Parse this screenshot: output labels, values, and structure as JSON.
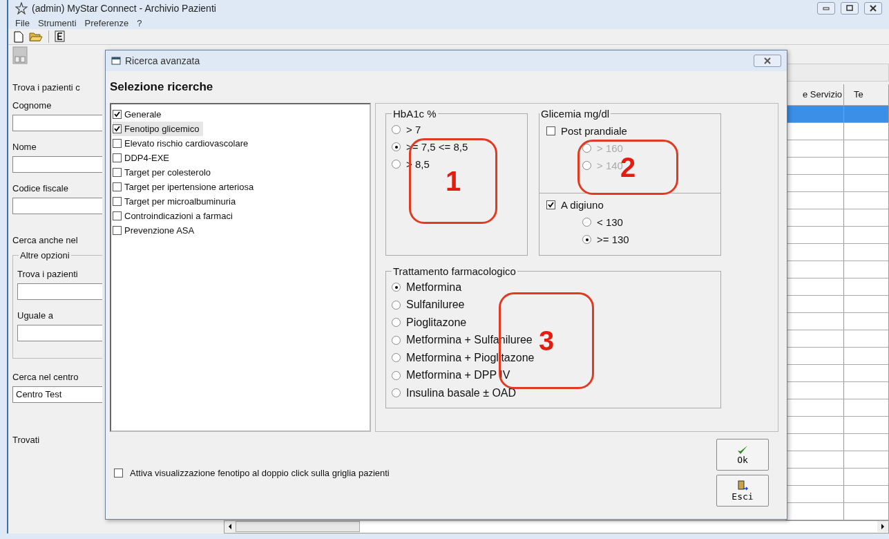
{
  "window": {
    "title": "(admin) MyStar Connect - Archivio Pazienti"
  },
  "menu": [
    "File",
    "Strumenti",
    "Preferenze",
    "?"
  ],
  "search_panel": {
    "intro": "Trova i pazienti c",
    "fields": [
      {
        "label": "Cognome"
      },
      {
        "label": "Nome"
      },
      {
        "label": "Codice fiscale"
      }
    ],
    "also_search": "Cerca anche nel",
    "other_options": {
      "title": "Altre opzioni",
      "fields": [
        {
          "label": "Trova i pazienti"
        },
        {
          "label": "Uguale a"
        }
      ]
    },
    "center": {
      "label": "Cerca nel centro",
      "value": "Centro Test"
    },
    "found": "Trovati"
  },
  "grid": {
    "columns": [
      "e Servizio",
      "Te"
    ],
    "rows": [
      {
        "selected": true
      },
      {
        "selected": false
      },
      {
        "selected": false
      },
      {
        "selected": false
      },
      {
        "selected": false
      },
      {
        "selected": false
      },
      {
        "selected": false
      },
      {
        "selected": false
      },
      {
        "selected": false
      },
      {
        "selected": false
      },
      {
        "selected": false
      },
      {
        "selected": false
      },
      {
        "selected": false
      },
      {
        "selected": false
      },
      {
        "selected": false
      },
      {
        "selected": false
      },
      {
        "selected": false
      },
      {
        "selected": false
      },
      {
        "selected": false
      },
      {
        "selected": false
      },
      {
        "selected": false
      },
      {
        "selected": false
      },
      {
        "selected": false
      },
      {
        "selected": false
      }
    ]
  },
  "dialog": {
    "title": "Ricerca avanzata",
    "heading": "Selezione ricerche",
    "searches": [
      {
        "label": "Generale",
        "checked": true,
        "selected": false
      },
      {
        "label": "Fenotipo glicemico",
        "checked": true,
        "selected": true
      },
      {
        "label": "Elevato rischio cardiovascolare",
        "checked": false,
        "selected": false
      },
      {
        "label": "DDP4-EXE",
        "checked": false,
        "selected": false
      },
      {
        "label": "Target per colesterolo",
        "checked": false,
        "selected": false
      },
      {
        "label": "Target per ipertensione arteriosa",
        "checked": false,
        "selected": false
      },
      {
        "label": "Target per microalbuminuria",
        "checked": false,
        "selected": false
      },
      {
        "label": "Controindicazioni a farmaci",
        "checked": false,
        "selected": false
      },
      {
        "label": "Prevenzione ASA",
        "checked": false,
        "selected": false
      }
    ],
    "hba1c": {
      "title": "HbA1c %",
      "options": [
        {
          "label": "> 7",
          "selected": false
        },
        {
          "label": ">= 7,5 <= 8,5",
          "selected": true
        },
        {
          "label": "> 8,5",
          "selected": false
        }
      ]
    },
    "glycemia": {
      "title": "Glicemia mg/dl",
      "sections": [
        {
          "label": "Post prandiale",
          "checked": false,
          "options": [
            {
              "label": "> 160",
              "selected": false
            },
            {
              "label": "> 140",
              "selected": false
            }
          ]
        },
        {
          "label": "A digiuno",
          "checked": true,
          "options": [
            {
              "label": "< 130",
              "selected": false
            },
            {
              "label": ">= 130",
              "selected": true
            }
          ]
        }
      ]
    },
    "treatment": {
      "title": "Trattamento farmacologico",
      "options": [
        {
          "label": "Metformina",
          "selected": true
        },
        {
          "label": "Sulfaniluree",
          "selected": false
        },
        {
          "label": "Pioglitazone",
          "selected": false
        },
        {
          "label": "Metformina + Sulfaniluree",
          "selected": false
        },
        {
          "label": "Metformina + Pioglitazone",
          "selected": false
        },
        {
          "label": "Metformina + DPP IV",
          "selected": false
        },
        {
          "label": "Insulina basale ± OAD",
          "selected": false
        }
      ]
    },
    "footer_checkbox": {
      "label": "Attiva visualizzazione fenotipo al doppio click sulla griglia pazienti",
      "checked": false
    },
    "buttons": [
      {
        "label": "Ok",
        "kind": "ok"
      },
      {
        "label": "Esci",
        "kind": "exit"
      }
    ]
  },
  "annotations": [
    {
      "label": "1"
    },
    {
      "label": "2"
    },
    {
      "label": "3"
    }
  ]
}
